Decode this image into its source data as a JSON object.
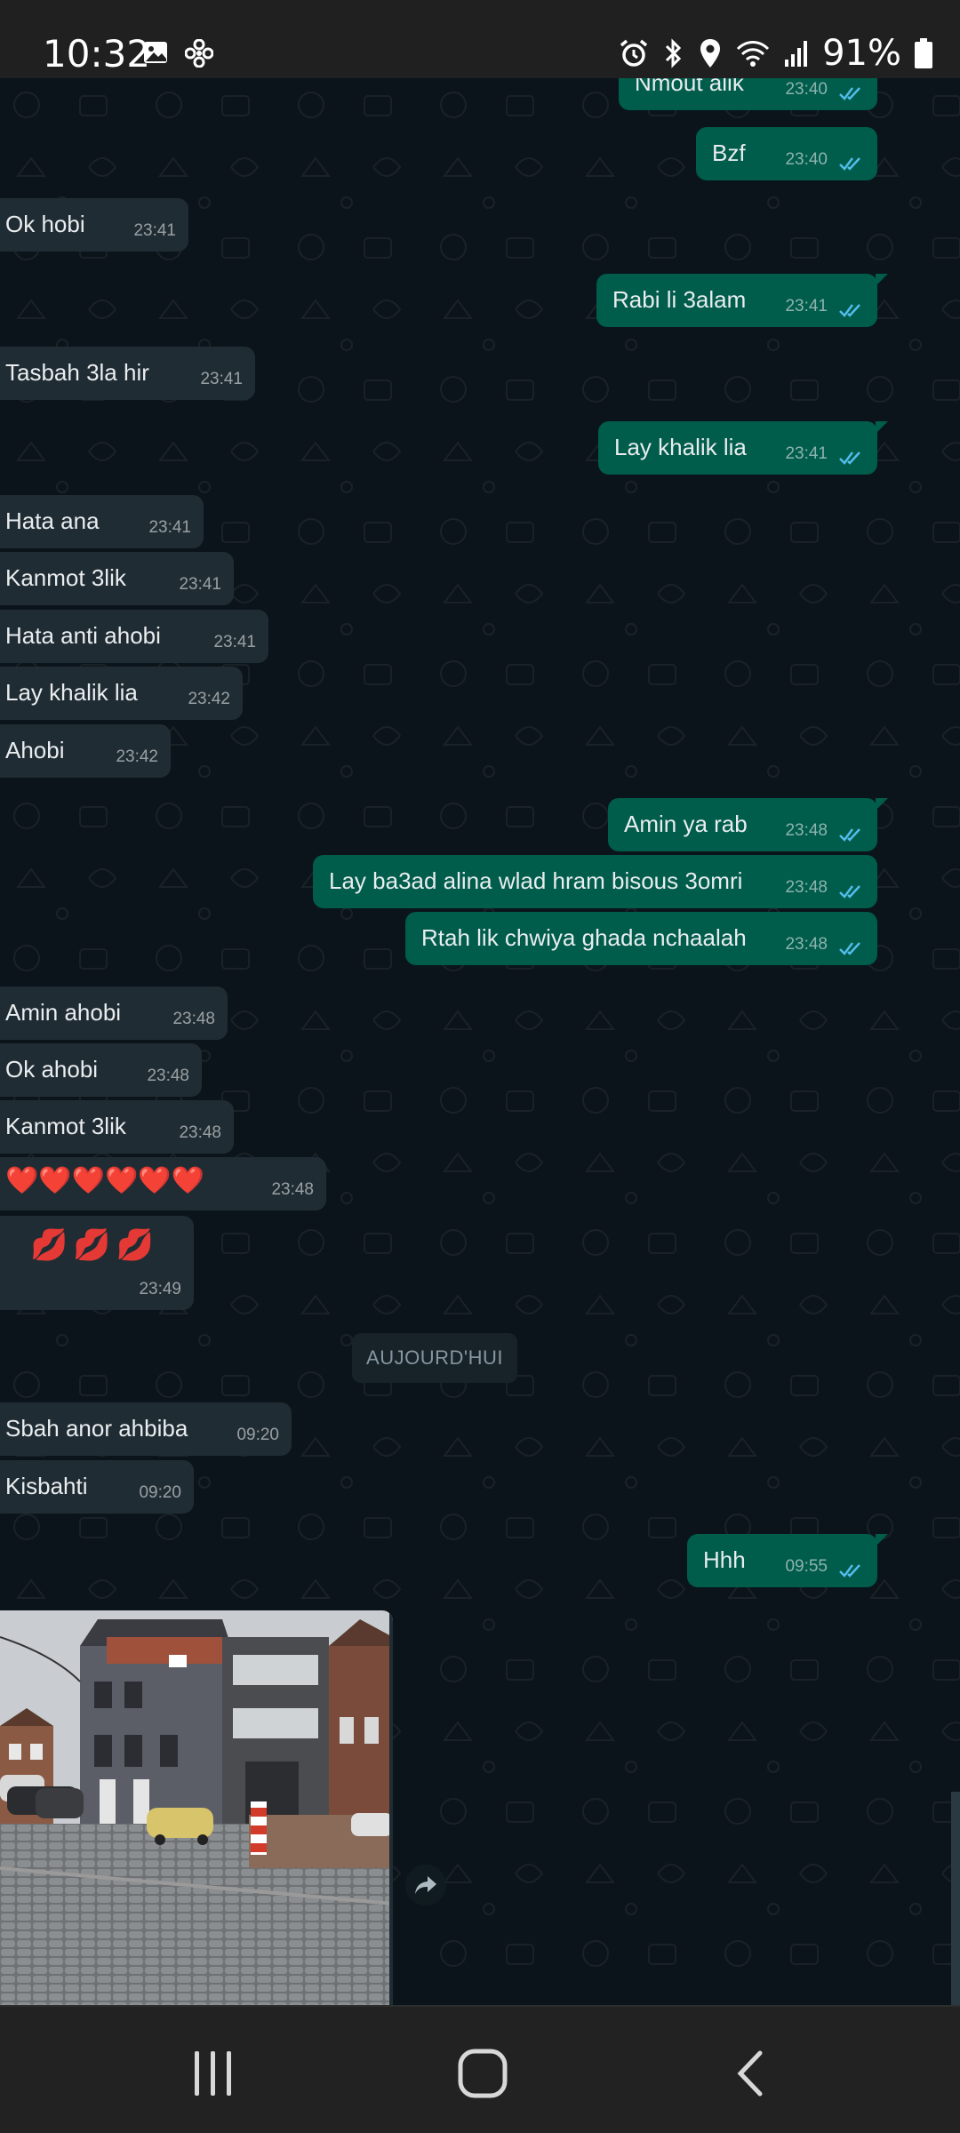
{
  "status_bar": {
    "time": "10:32",
    "battery": "91%",
    "left_icons": [
      "gallery-icon",
      "fan-icon"
    ],
    "right_icons": [
      "alarm-icon",
      "bluetooth-icon",
      "location-icon",
      "wifi-icon",
      "signal-icon",
      "battery-icon"
    ]
  },
  "messages": [
    {
      "dir": "out",
      "text": "Nmout alik",
      "time": "23:40"
    },
    {
      "dir": "out",
      "text": "Bzf",
      "time": "23:40"
    },
    {
      "dir": "in",
      "text": "Ok hobi",
      "time": "23:41"
    },
    {
      "dir": "out",
      "text": "Rabi li 3alam",
      "time": "23:41"
    },
    {
      "dir": "in",
      "text": "Tasbah 3la hir",
      "time": "23:41"
    },
    {
      "dir": "out",
      "text": "Lay khalik lia",
      "time": "23:41"
    },
    {
      "dir": "in",
      "text": "Hata ana",
      "time": "23:41"
    },
    {
      "dir": "in",
      "text": "Kanmot 3lik",
      "time": "23:41"
    },
    {
      "dir": "in",
      "text": "Hata anti ahobi",
      "time": "23:41"
    },
    {
      "dir": "in",
      "text": "Lay khalik lia",
      "time": "23:42"
    },
    {
      "dir": "in",
      "text": "Ahobi",
      "time": "23:42"
    },
    {
      "dir": "out",
      "text": "Amin ya rab",
      "time": "23:48"
    },
    {
      "dir": "out",
      "text": "Lay ba3ad alina wlad hram bisous 3omri",
      "time": "23:48"
    },
    {
      "dir": "out",
      "text": "Rtah lik chwiya ghada nchaalah",
      "time": "23:48"
    },
    {
      "dir": "in",
      "text": "Amin ahobi",
      "time": "23:48"
    },
    {
      "dir": "in",
      "text": "Ok ahobi",
      "time": "23:48"
    },
    {
      "dir": "in",
      "text": "Kanmot 3lik",
      "time": "23:48"
    },
    {
      "dir": "in",
      "text": "❤️❤️❤️❤️❤️❤️",
      "time": "23:48"
    },
    {
      "dir": "in",
      "text": "💋💋💋",
      "time": "23:49"
    },
    {
      "dir": "in",
      "text": "Sbah anor ahbiba",
      "time": "09:20"
    },
    {
      "dir": "in",
      "text": "Kisbahti",
      "time": "09:20"
    },
    {
      "dir": "out",
      "text": "Hhh",
      "time": "09:55"
    }
  ],
  "date_divider": "AUJOURD'HUI",
  "colors": {
    "background": "#0b141a",
    "incoming_bubble": "#202c33",
    "outgoing_bubble": "#005c4b",
    "read_ticks": "#53bdeb"
  },
  "attachments": {
    "photo_icon": "street-photo",
    "forward_icon": "forward-icon"
  },
  "nav_bar": {
    "icons": [
      "recent-apps-icon",
      "home-icon",
      "back-icon"
    ]
  }
}
